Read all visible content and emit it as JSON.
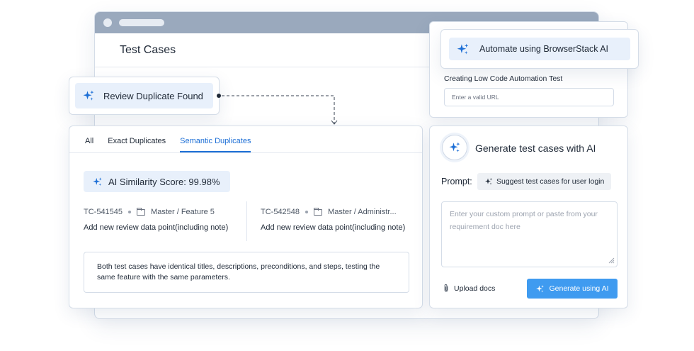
{
  "background_window": {
    "title": "Test Cases"
  },
  "review_card": {
    "label": "Review Duplicate Found",
    "icon": "sparkle-icon"
  },
  "duplicates_panel": {
    "tabs": [
      {
        "label": "All",
        "active": false
      },
      {
        "label": "Exact Duplicates",
        "active": false
      },
      {
        "label": "Semantic Duplicates",
        "active": true
      }
    ],
    "score_label": "AI Similarity Score: 99.98%",
    "test_cases": [
      {
        "id": "TC-541545",
        "path": "Master / Feature 5",
        "description": "Add new review data point(including note)"
      },
      {
        "id": "TC-542548",
        "path": "Master / Administr...",
        "description": "Add new review data point(including note)"
      }
    ],
    "explanation": "Both test cases have identical titles, descriptions, preconditions, and steps, testing the same feature with the same parameters."
  },
  "automate_card": {
    "button_label": "Automate using BrowserStack AI",
    "section_label": "Creating Low Code Automation Test",
    "url_placeholder": "Enter a valid URL"
  },
  "generate_card": {
    "title": "Generate test cases with AI",
    "prompt_label": "Prompt:",
    "suggestion": "Suggest test cases for user login",
    "prompt_placeholder": "Enter your custom prompt or paste from your requirement doc here",
    "upload_label": "Upload docs",
    "generate_label": "Generate using AI"
  },
  "colors": {
    "accent": "#1d6fd6",
    "button": "#3f9bf0",
    "highlight": "#e8f0fb",
    "titlebar": "#9aa9bd"
  }
}
